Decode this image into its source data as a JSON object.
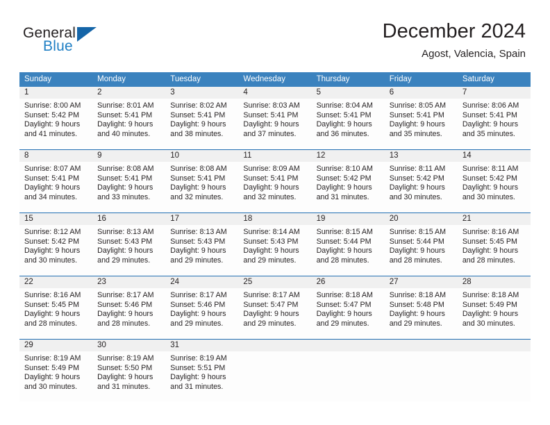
{
  "brand": {
    "name_part1": "General",
    "name_part2": "Blue",
    "triangle_color": "#1565a8",
    "accent_color": "#1f7fc4"
  },
  "header": {
    "month_title": "December 2024",
    "location": "Agost, Valencia, Spain"
  },
  "calendar": {
    "header_color": "#3b82be",
    "week_divider_color": "#1f6cb0",
    "date_band_color": "#f0f0f0",
    "weekdays": [
      "Sunday",
      "Monday",
      "Tuesday",
      "Wednesday",
      "Thursday",
      "Friday",
      "Saturday"
    ],
    "weeks": [
      {
        "days": [
          {
            "num": "1",
            "sunrise": "Sunrise: 8:00 AM",
            "sunset": "Sunset: 5:42 PM",
            "daylight_l1": "Daylight: 9 hours",
            "daylight_l2": "and 41 minutes."
          },
          {
            "num": "2",
            "sunrise": "Sunrise: 8:01 AM",
            "sunset": "Sunset: 5:41 PM",
            "daylight_l1": "Daylight: 9 hours",
            "daylight_l2": "and 40 minutes."
          },
          {
            "num": "3",
            "sunrise": "Sunrise: 8:02 AM",
            "sunset": "Sunset: 5:41 PM",
            "daylight_l1": "Daylight: 9 hours",
            "daylight_l2": "and 38 minutes."
          },
          {
            "num": "4",
            "sunrise": "Sunrise: 8:03 AM",
            "sunset": "Sunset: 5:41 PM",
            "daylight_l1": "Daylight: 9 hours",
            "daylight_l2": "and 37 minutes."
          },
          {
            "num": "5",
            "sunrise": "Sunrise: 8:04 AM",
            "sunset": "Sunset: 5:41 PM",
            "daylight_l1": "Daylight: 9 hours",
            "daylight_l2": "and 36 minutes."
          },
          {
            "num": "6",
            "sunrise": "Sunrise: 8:05 AM",
            "sunset": "Sunset: 5:41 PM",
            "daylight_l1": "Daylight: 9 hours",
            "daylight_l2": "and 35 minutes."
          },
          {
            "num": "7",
            "sunrise": "Sunrise: 8:06 AM",
            "sunset": "Sunset: 5:41 PM",
            "daylight_l1": "Daylight: 9 hours",
            "daylight_l2": "and 35 minutes."
          }
        ]
      },
      {
        "days": [
          {
            "num": "8",
            "sunrise": "Sunrise: 8:07 AM",
            "sunset": "Sunset: 5:41 PM",
            "daylight_l1": "Daylight: 9 hours",
            "daylight_l2": "and 34 minutes."
          },
          {
            "num": "9",
            "sunrise": "Sunrise: 8:08 AM",
            "sunset": "Sunset: 5:41 PM",
            "daylight_l1": "Daylight: 9 hours",
            "daylight_l2": "and 33 minutes."
          },
          {
            "num": "10",
            "sunrise": "Sunrise: 8:08 AM",
            "sunset": "Sunset: 5:41 PM",
            "daylight_l1": "Daylight: 9 hours",
            "daylight_l2": "and 32 minutes."
          },
          {
            "num": "11",
            "sunrise": "Sunrise: 8:09 AM",
            "sunset": "Sunset: 5:41 PM",
            "daylight_l1": "Daylight: 9 hours",
            "daylight_l2": "and 32 minutes."
          },
          {
            "num": "12",
            "sunrise": "Sunrise: 8:10 AM",
            "sunset": "Sunset: 5:42 PM",
            "daylight_l1": "Daylight: 9 hours",
            "daylight_l2": "and 31 minutes."
          },
          {
            "num": "13",
            "sunrise": "Sunrise: 8:11 AM",
            "sunset": "Sunset: 5:42 PM",
            "daylight_l1": "Daylight: 9 hours",
            "daylight_l2": "and 30 minutes."
          },
          {
            "num": "14",
            "sunrise": "Sunrise: 8:11 AM",
            "sunset": "Sunset: 5:42 PM",
            "daylight_l1": "Daylight: 9 hours",
            "daylight_l2": "and 30 minutes."
          }
        ]
      },
      {
        "days": [
          {
            "num": "15",
            "sunrise": "Sunrise: 8:12 AM",
            "sunset": "Sunset: 5:42 PM",
            "daylight_l1": "Daylight: 9 hours",
            "daylight_l2": "and 30 minutes."
          },
          {
            "num": "16",
            "sunrise": "Sunrise: 8:13 AM",
            "sunset": "Sunset: 5:43 PM",
            "daylight_l1": "Daylight: 9 hours",
            "daylight_l2": "and 29 minutes."
          },
          {
            "num": "17",
            "sunrise": "Sunrise: 8:13 AM",
            "sunset": "Sunset: 5:43 PM",
            "daylight_l1": "Daylight: 9 hours",
            "daylight_l2": "and 29 minutes."
          },
          {
            "num": "18",
            "sunrise": "Sunrise: 8:14 AM",
            "sunset": "Sunset: 5:43 PM",
            "daylight_l1": "Daylight: 9 hours",
            "daylight_l2": "and 29 minutes."
          },
          {
            "num": "19",
            "sunrise": "Sunrise: 8:15 AM",
            "sunset": "Sunset: 5:44 PM",
            "daylight_l1": "Daylight: 9 hours",
            "daylight_l2": "and 28 minutes."
          },
          {
            "num": "20",
            "sunrise": "Sunrise: 8:15 AM",
            "sunset": "Sunset: 5:44 PM",
            "daylight_l1": "Daylight: 9 hours",
            "daylight_l2": "and 28 minutes."
          },
          {
            "num": "21",
            "sunrise": "Sunrise: 8:16 AM",
            "sunset": "Sunset: 5:45 PM",
            "daylight_l1": "Daylight: 9 hours",
            "daylight_l2": "and 28 minutes."
          }
        ]
      },
      {
        "days": [
          {
            "num": "22",
            "sunrise": "Sunrise: 8:16 AM",
            "sunset": "Sunset: 5:45 PM",
            "daylight_l1": "Daylight: 9 hours",
            "daylight_l2": "and 28 minutes."
          },
          {
            "num": "23",
            "sunrise": "Sunrise: 8:17 AM",
            "sunset": "Sunset: 5:46 PM",
            "daylight_l1": "Daylight: 9 hours",
            "daylight_l2": "and 28 minutes."
          },
          {
            "num": "24",
            "sunrise": "Sunrise: 8:17 AM",
            "sunset": "Sunset: 5:46 PM",
            "daylight_l1": "Daylight: 9 hours",
            "daylight_l2": "and 29 minutes."
          },
          {
            "num": "25",
            "sunrise": "Sunrise: 8:17 AM",
            "sunset": "Sunset: 5:47 PM",
            "daylight_l1": "Daylight: 9 hours",
            "daylight_l2": "and 29 minutes."
          },
          {
            "num": "26",
            "sunrise": "Sunrise: 8:18 AM",
            "sunset": "Sunset: 5:47 PM",
            "daylight_l1": "Daylight: 9 hours",
            "daylight_l2": "and 29 minutes."
          },
          {
            "num": "27",
            "sunrise": "Sunrise: 8:18 AM",
            "sunset": "Sunset: 5:48 PM",
            "daylight_l1": "Daylight: 9 hours",
            "daylight_l2": "and 29 minutes."
          },
          {
            "num": "28",
            "sunrise": "Sunrise: 8:18 AM",
            "sunset": "Sunset: 5:49 PM",
            "daylight_l1": "Daylight: 9 hours",
            "daylight_l2": "and 30 minutes."
          }
        ]
      },
      {
        "days": [
          {
            "num": "29",
            "sunrise": "Sunrise: 8:19 AM",
            "sunset": "Sunset: 5:49 PM",
            "daylight_l1": "Daylight: 9 hours",
            "daylight_l2": "and 30 minutes."
          },
          {
            "num": "30",
            "sunrise": "Sunrise: 8:19 AM",
            "sunset": "Sunset: 5:50 PM",
            "daylight_l1": "Daylight: 9 hours",
            "daylight_l2": "and 31 minutes."
          },
          {
            "num": "31",
            "sunrise": "Sunrise: 8:19 AM",
            "sunset": "Sunset: 5:51 PM",
            "daylight_l1": "Daylight: 9 hours",
            "daylight_l2": "and 31 minutes."
          },
          {
            "num": "",
            "sunrise": "",
            "sunset": "",
            "daylight_l1": "",
            "daylight_l2": ""
          },
          {
            "num": "",
            "sunrise": "",
            "sunset": "",
            "daylight_l1": "",
            "daylight_l2": ""
          },
          {
            "num": "",
            "sunrise": "",
            "sunset": "",
            "daylight_l1": "",
            "daylight_l2": ""
          },
          {
            "num": "",
            "sunrise": "",
            "sunset": "",
            "daylight_l1": "",
            "daylight_l2": ""
          }
        ]
      }
    ]
  }
}
